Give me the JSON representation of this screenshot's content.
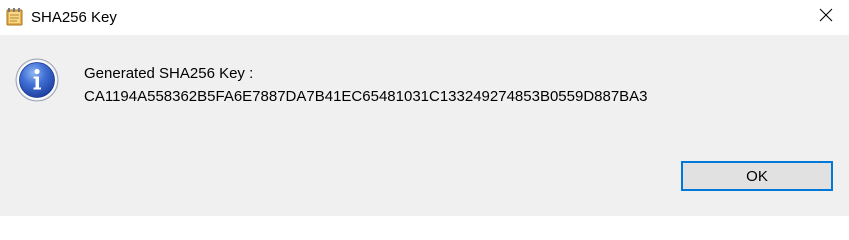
{
  "window": {
    "title": "SHA256 Key",
    "app_icon": "notepad-icon",
    "close_icon": "close-icon"
  },
  "message": {
    "icon": "info-icon",
    "line1": "Generated SHA256 Key :",
    "line2": "CA1194A558362B5FA6E7887DA7B41EC65481031C133249274853B0559D887BA3"
  },
  "buttons": {
    "ok_label": "OK"
  },
  "colors": {
    "focus_border": "#0078d7",
    "dialog_bg": "#f0f0f0",
    "button_bg": "#e1e1e1"
  }
}
